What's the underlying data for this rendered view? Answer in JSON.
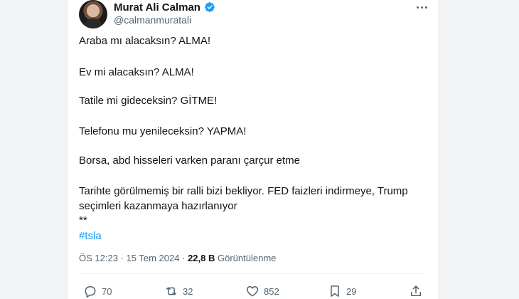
{
  "author": {
    "name": "Murat Ali Calman",
    "handle": "@calmanmuratali"
  },
  "tweet": {
    "lines": [
      "Araba mı alacaksın? ALMA!",
      "Ev mi alacaksın? ALMA!",
      "Tatile mi gideceksin? GİTME!",
      "Telefonu mu yenileceksin? YAPMA!",
      "Borsa, abd hisseleri varken paranı çarçur etme",
      "Tarihte görülmemiş bir ralli bizi bekliyor. FED faizleri indirmeye, Trump",
      "seçimleri kazanmaya hazırlanıyor",
      "**"
    ],
    "hashtag": "#tsla"
  },
  "meta": {
    "time": "ÖS 12:23",
    "separator": "·",
    "date": "15 Tem 2024",
    "views": "22,8 B",
    "views_label": "Görüntülenme"
  },
  "actions": {
    "replies": "70",
    "reposts": "32",
    "likes": "852",
    "bookmarks": "29"
  },
  "colors": {
    "accent": "#1d9bf0",
    "text": "#0f1419",
    "secondary": "#536471"
  }
}
